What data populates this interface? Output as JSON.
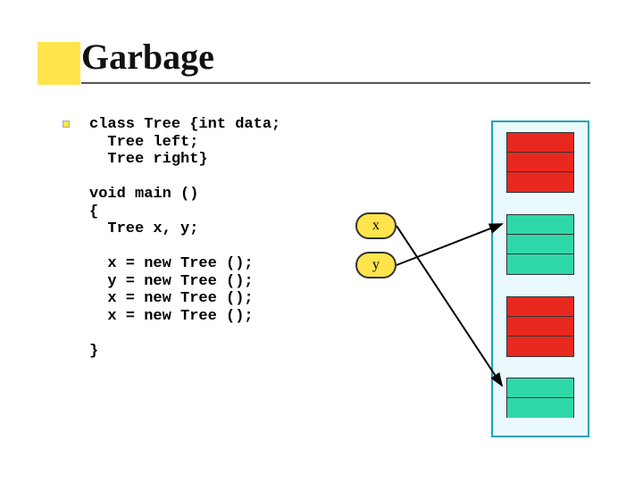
{
  "title": "Garbage",
  "code": "class Tree {int data;\n  Tree left;\n  Tree right}\n\nvoid main ()\n{\n  Tree x, y;\n\n  x = new Tree ();\n  y = new Tree ();\n  x = new Tree ();\n  x = new Tree ();\n\n}",
  "vars": {
    "x": "x",
    "y": "y"
  },
  "heap": {
    "objects": [
      {
        "cells": [
          "red",
          "red",
          "red"
        ]
      },
      {
        "cells": [
          "green",
          "green",
          "green"
        ]
      },
      {
        "cells": [
          "red",
          "red",
          "red"
        ]
      },
      {
        "cells": [
          "green",
          "green"
        ]
      }
    ]
  },
  "colors": {
    "accent": "#ffe44d",
    "heap_border": "#1aa3b8",
    "red": "#e8281f",
    "green": "#2fd8a8"
  }
}
